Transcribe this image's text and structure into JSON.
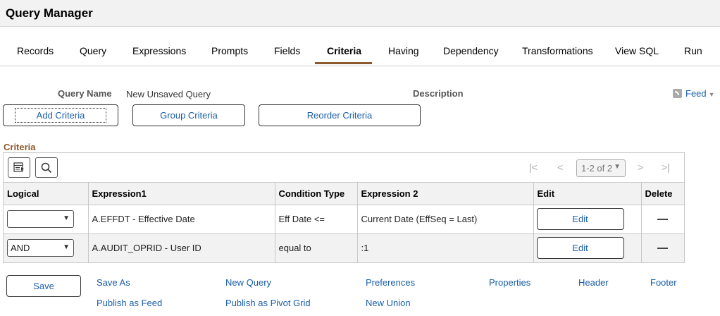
{
  "header": {
    "title": "Query Manager"
  },
  "tabs": [
    {
      "label": "Records"
    },
    {
      "label": "Query"
    },
    {
      "label": "Expressions"
    },
    {
      "label": "Prompts"
    },
    {
      "label": "Fields"
    },
    {
      "label": "Criteria",
      "active": true
    },
    {
      "label": "Having"
    },
    {
      "label": "Dependency"
    },
    {
      "label": "Transformations"
    },
    {
      "label": "View SQL"
    },
    {
      "label": "Run"
    }
  ],
  "query": {
    "name_label": "Query Name",
    "name_value": "New Unsaved Query",
    "description_label": "Description"
  },
  "feed": {
    "label": "Feed",
    "icon": "rss-feed-icon"
  },
  "buttons": {
    "add_criteria": "Add Criteria",
    "group_criteria": "Group Criteria",
    "reorder_criteria": "Reorder Criteria"
  },
  "criteria": {
    "title": "Criteria",
    "pager": {
      "text": "1-2 of 2"
    },
    "columns": [
      "Logical",
      "Expression1",
      "Condition Type",
      "Expression 2",
      "Edit",
      "Delete"
    ],
    "rows": [
      {
        "logical": "",
        "expression1": "A.EFFDT - Effective Date",
        "condition": "Eff Date <=",
        "expression2": "Current Date (EffSeq = Last)",
        "edit": "Edit"
      },
      {
        "logical": "AND",
        "expression1": "A.AUDIT_OPRID - User ID",
        "condition": "equal to",
        "expression2": ":1",
        "edit": "Edit"
      }
    ]
  },
  "footer": {
    "save": "Save",
    "links": {
      "save_as": "Save As",
      "new_query": "New Query",
      "preferences": "Preferences",
      "properties": "Properties",
      "header": "Header",
      "footer": "Footer",
      "publish_feed": "Publish as Feed",
      "publish_pivot": "Publish as Pivot Grid",
      "new_union": "New Union"
    }
  },
  "colors": {
    "link": "#1a5ea8",
    "accent": "#8c5a2e",
    "header_bg": "#f2f2f2"
  }
}
